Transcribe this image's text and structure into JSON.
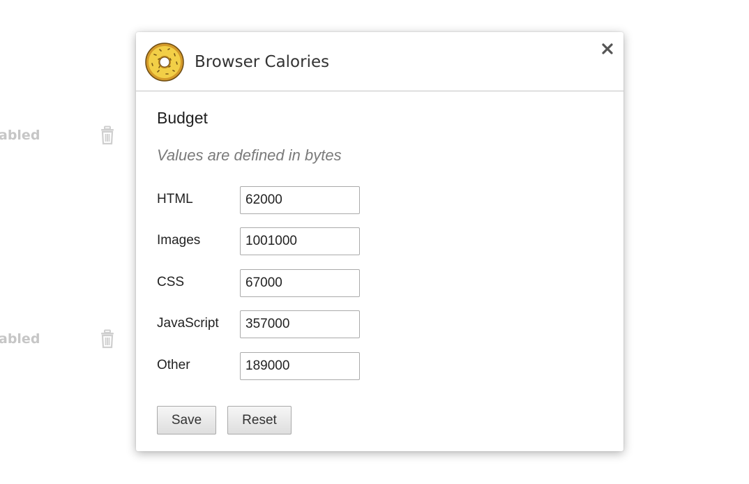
{
  "background": {
    "rows": [
      {
        "status": "abled",
        "icon": "trash-icon"
      },
      {
        "status": "abled",
        "icon": "trash-icon"
      }
    ]
  },
  "dialog": {
    "app_title": "Browser Calories",
    "logo_icon": "donut-icon",
    "close_icon": "close-icon",
    "section_title": "Budget",
    "subtitle": "Values are defined in bytes",
    "fields": [
      {
        "label": "HTML",
        "value": "62000"
      },
      {
        "label": "Images",
        "value": "1001000"
      },
      {
        "label": "CSS",
        "value": "67000"
      },
      {
        "label": "JavaScript",
        "value": "357000"
      },
      {
        "label": "Other",
        "value": "189000"
      }
    ],
    "buttons": {
      "save_label": "Save",
      "reset_label": "Reset"
    }
  },
  "colors": {
    "header_divider": "#c3c3c3",
    "subtitle_text": "#7a7a7a",
    "background_status_text": "#c6c6c6",
    "donut_dough": "#e9b63c",
    "donut_frosting": "#f2cf47"
  }
}
